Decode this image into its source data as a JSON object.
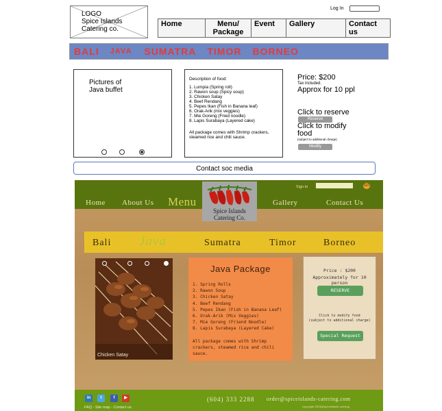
{
  "wireframe": {
    "logo_lines": [
      "LOGO",
      "Spice Islands",
      "Catering co."
    ],
    "login_label": "Log In",
    "nav": [
      {
        "label": "Home"
      },
      {
        "label": "Menu/ Package"
      },
      {
        "label": "Event"
      },
      {
        "label": "Gallery"
      },
      {
        "label": "Contact us"
      }
    ],
    "regions": [
      {
        "label": "BALI",
        "selected": false
      },
      {
        "label": "JAVA",
        "selected": true
      },
      {
        "label": "SUMATRA",
        "selected": false
      },
      {
        "label": "TIMOR",
        "selected": false
      },
      {
        "label": "BORNEO",
        "selected": false
      }
    ],
    "picture_label": [
      "Pictures of",
      "Java buffet"
    ],
    "carousel_active_index": 2,
    "description_heading": "Description of food:",
    "food_items": [
      "1. Lumpia (Spring roll)",
      "2. Rawon soup (Spicy soup)",
      "3. Chicken Satay",
      "4. Beef Rendang",
      "5. Pepes Ikan (Fish in Banana leaf)",
      "6. Orak-Arik (mix veggies)",
      "7. Mie Goreng (Fried noodle)",
      "8. Lapis Surabaya (Layered cake)"
    ],
    "description_footer": "All package comes with Shrimp crackers, steamed rice and chili sauce.",
    "price": "Price: $200",
    "tax_note": "Tax included.",
    "approx": "Approx for 10 ppl",
    "reserve_prompt": "Click to reserve",
    "reserve_button": "Reserve",
    "modify_prompt": "Click to modify food",
    "modify_note": "(subject to additional charge)",
    "modify_button": "Modify",
    "contact_bar": "Contact   soc media"
  },
  "mockup": {
    "sign_in_label": "Sign in",
    "go_label": "GO",
    "nav": [
      {
        "label": "Home"
      },
      {
        "label": "About Us"
      },
      {
        "label": "Menu"
      },
      {
        "label": "Gallery"
      },
      {
        "label": "Contact Us"
      }
    ],
    "logo_text": [
      "Spice Islands",
      "Catering Co."
    ],
    "regions": [
      {
        "label": "Bali",
        "selected": false
      },
      {
        "label": "Java",
        "selected": true
      },
      {
        "label": "Sumatra",
        "selected": false
      },
      {
        "label": "Timor",
        "selected": false
      },
      {
        "label": "Borneo",
        "selected": false
      }
    ],
    "photo_caption": "Chicken Satay",
    "carousel_active_index": 3,
    "package_title": "Java Package",
    "package_items": [
      "1. Spring Rolls",
      "2. Rawon Soup",
      "3. Chicken Satay",
      "4. Beef Rendang",
      "5. Pepes Ikan (Fish in Banana Leaf)",
      "6. Orak-Arik (Mix Veggies)",
      "7. Mie Goreng (Friend Noodle)",
      "8. Lapis Surabaya (Layered Cake)"
    ],
    "package_footer": "All package comes with Shrimp crackers, steamed rice and chili sauce.",
    "price": "Price : $200",
    "approx": "Approximately for 10 person",
    "reserve_button": "RESERVE",
    "modify_note_1": "Click to modify food",
    "modify_note_2": "(subject to additional charge)",
    "special_request_button": "Special Request",
    "social": [
      {
        "name": "linkedin-icon",
        "glyph": "in",
        "color": "#2d79b8"
      },
      {
        "name": "twitter-icon",
        "glyph": "t",
        "color": "#49a9e0"
      },
      {
        "name": "facebook-icon",
        "glyph": "f",
        "color": "#3b5db0"
      },
      {
        "name": "youtube-icon",
        "glyph": "▶",
        "color": "#d23a2a"
      }
    ],
    "footer_links": "FAQ - Site map - Contact us",
    "phone": "(604) 333 2288",
    "email": "order@spiceislands-catering.com",
    "copyright": "copyright 2012@spiceislands catering"
  }
}
